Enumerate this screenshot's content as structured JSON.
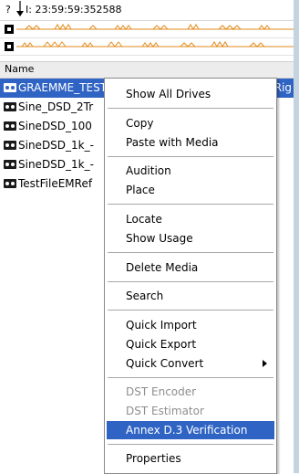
{
  "topbar": {
    "question": "?",
    "time": "I: 23:59:59:352588"
  },
  "file_rows": [
    {
      "name": "GRAEMME_TEST_SFTS2_1.12.Dorst_Quads_TM.Rig",
      "selected": true
    },
    {
      "name": "Sine_DSD_2Tr"
    },
    {
      "name": "SineDSD_100"
    },
    {
      "name": "SineDSD_1k_-"
    },
    {
      "name": "SineDSD_1k_-"
    },
    {
      "name": "TestFileEMRef"
    }
  ],
  "name_header": "Name",
  "menu": {
    "show_all_drives": "Show All Drives",
    "copy": "Copy",
    "paste_with_media": "Paste with Media",
    "audition": "Audition",
    "place": "Place",
    "locate": "Locate",
    "show_usage": "Show Usage",
    "delete_media": "Delete Media",
    "search": "Search",
    "quick_import": "Quick Import",
    "quick_export": "Quick Export",
    "quick_convert": "Quick Convert",
    "dst_encoder": "DST Encoder",
    "dst_estimator": "DST Estimator",
    "annex_verification": "Annex D.3 Verification",
    "properties": "Properties"
  },
  "colors": {
    "selection": "#3064c4",
    "track_wave": "#e08a1a",
    "sidebar": "#c4d3e0"
  }
}
